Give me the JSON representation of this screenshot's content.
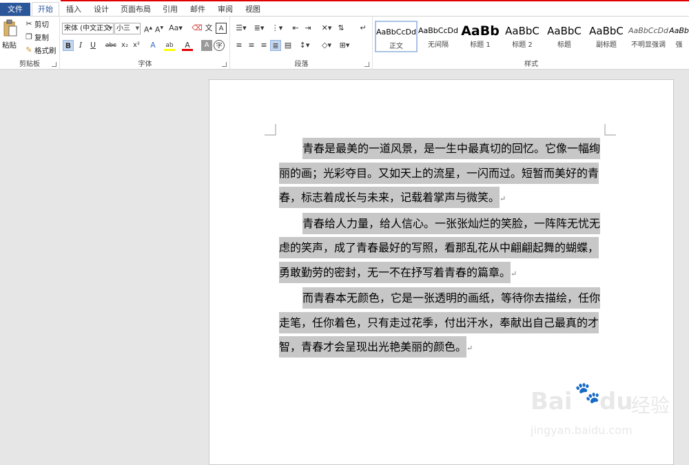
{
  "tabs": [
    "文件",
    "开始",
    "插入",
    "设计",
    "页面布局",
    "引用",
    "邮件",
    "审阅",
    "视图"
  ],
  "clipboard": {
    "paste": "粘贴",
    "cut": "剪切",
    "copy": "复制",
    "format_painter": "格式刷",
    "group_label": "剪贴板"
  },
  "font": {
    "font_name": "宋体 (中文正文",
    "font_size": "小三",
    "group_label": "字体"
  },
  "paragraph": {
    "group_label": "段落"
  },
  "styles": {
    "group_label": "样式",
    "items": [
      {
        "sample": "AaBbCcDd",
        "name": "正文"
      },
      {
        "sample": "AaBbCcDd",
        "name": "无间隔"
      },
      {
        "sample": "AaBb",
        "name": "标题 1"
      },
      {
        "sample": "AaBbC",
        "name": "标题 2"
      },
      {
        "sample": "AaBbC",
        "name": "标题"
      },
      {
        "sample": "AaBbC",
        "name": "副标题"
      },
      {
        "sample": "AaBbCcDd",
        "name": "不明显强调"
      },
      {
        "sample": "AaBb",
        "name": "强"
      }
    ]
  },
  "document": {
    "paragraphs": [
      "青春是最美的一道风景，是一生中最真切的回忆。它像一幅绚丽的画；光彩夺目。又如天上的流星，一闪而过。短暂而美好的青春，标志着成长与未来，记载着掌声与微笑。",
      "青春给人力量，给人信心。一张张灿烂的笑脸，一阵阵无忧无虑的笑声，成了青春最好的写照，看那乱花从中翩翩起舞的蝴蝶，勇敢勤劳的密封，无一不在抒写着青春的篇章。",
      "而青春本无颜色，它是一张透明的画纸，等待你去描绘，任你走笔，任你着色，只有走过花季，付出汗水，奉献出自己最真的才智，青春才会呈现出光艳美丽的颜色。"
    ],
    "paragraph_mark": "↵"
  },
  "watermark": {
    "brand": "Bai",
    "brand2": "du",
    "brand3": "经验",
    "url": "jingyan.baidu.com"
  },
  "colors": {
    "accent": "#2b579a",
    "highlight": "#c7c7c7",
    "top_line": "#e00000"
  }
}
